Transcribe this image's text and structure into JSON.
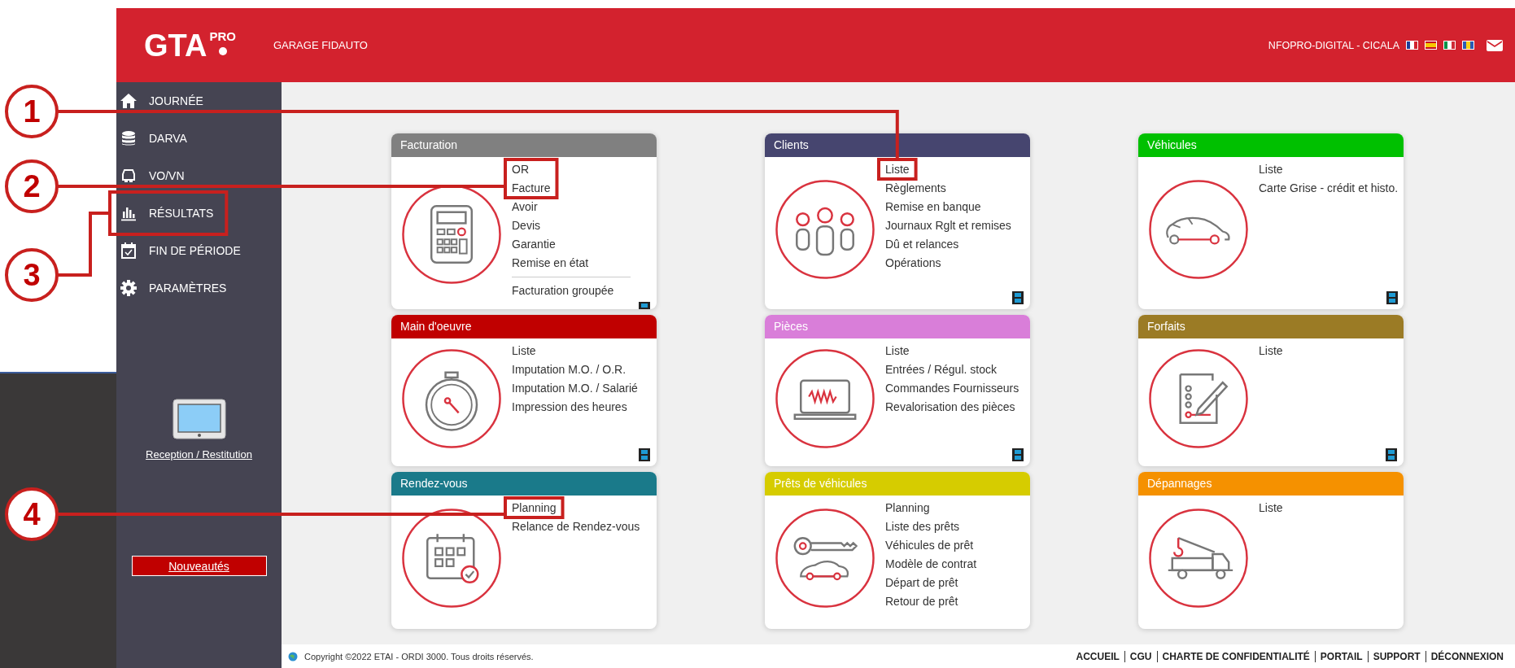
{
  "header": {
    "logo": {
      "text": "GTA",
      "superscript": "PRO"
    },
    "garage": "GARAGE FIDAUTO",
    "user": "NFOPRO-DIGITAL - CICALA"
  },
  "sidebar": {
    "items": [
      {
        "label": "JOURNÉE"
      },
      {
        "label": "DARVA"
      },
      {
        "label": "VO/VN"
      },
      {
        "label": "RÉSULTATS",
        "callout": "3"
      },
      {
        "label": "FIN DE PÉRIODE"
      },
      {
        "label": "PARAMÈTRES"
      }
    ],
    "reception_link": "Reception / Restitution",
    "news_button": "Nouveautés"
  },
  "cards": [
    {
      "title": "Facturation",
      "color": "#808080",
      "video": true,
      "items": [
        {
          "label": "OR",
          "callout": "2"
        },
        {
          "label": "Facture",
          "joins_callout_above": true
        },
        {
          "label": "Avoir"
        },
        {
          "label": "Devis"
        },
        {
          "label": "Garantie"
        },
        {
          "label": "Remise en état"
        }
      ],
      "footer_link": "Facturation groupée"
    },
    {
      "title": "Clients",
      "color": "#46456f",
      "video": true,
      "items": [
        {
          "label": "Liste",
          "callout": "1"
        },
        {
          "label": "Règlements"
        },
        {
          "label": "Remise en banque"
        },
        {
          "label": "Journaux Rglt et remises"
        },
        {
          "label": "Dû et relances"
        },
        {
          "label": "Opérations"
        }
      ]
    },
    {
      "title": "Véhicules",
      "color": "#00c000",
      "video": true,
      "items": [
        {
          "label": "Liste"
        },
        {
          "label": "Carte Grise - crédit et histo."
        }
      ]
    },
    {
      "title": "Main d'oeuvre",
      "color": "#c00000",
      "video": true,
      "items": [
        {
          "label": "Liste"
        },
        {
          "label": "Imputation M.O. / O.R."
        },
        {
          "label": "Imputation M.O. / Salarié"
        },
        {
          "label": "Impression des heures"
        }
      ]
    },
    {
      "title": "Pièces",
      "color": "#d97ed9",
      "video": true,
      "items": [
        {
          "label": "Liste"
        },
        {
          "label": "Entrées / Régul. stock"
        },
        {
          "label": "Commandes Fournisseurs"
        },
        {
          "label": "Revalorisation des pièces"
        }
      ]
    },
    {
      "title": "Forfaits",
      "color": "#9b7b25",
      "video": true,
      "items": [
        {
          "label": "Liste"
        }
      ]
    },
    {
      "title": "Rendez-vous",
      "color": "#1a7a8a",
      "video": false,
      "items": [
        {
          "label": "Planning",
          "callout": "4"
        },
        {
          "label": "Relance de Rendez-vous"
        }
      ]
    },
    {
      "title": "Prêts de véhicules",
      "color": "#d6cc00",
      "video": false,
      "items": [
        {
          "label": "Planning"
        },
        {
          "label": "Liste des prêts"
        },
        {
          "label": "Véhicules de prêt"
        },
        {
          "label": "Modèle de contrat"
        },
        {
          "label": "Départ de prêt"
        },
        {
          "label": "Retour de prêt"
        }
      ]
    },
    {
      "title": "Dépannages",
      "color": "#f59100",
      "video": false,
      "items": [
        {
          "label": "Liste"
        }
      ]
    }
  ],
  "footer": {
    "copyright": "Copyright ©2022 ETAI - ORDI 3000. Tous droits réservés.",
    "links": [
      "ACCUEIL",
      "CGU",
      "CHARTE DE CONFIDENTIALITÉ",
      "PORTAIL",
      "SUPPORT",
      "DÉCONNEXION"
    ]
  }
}
